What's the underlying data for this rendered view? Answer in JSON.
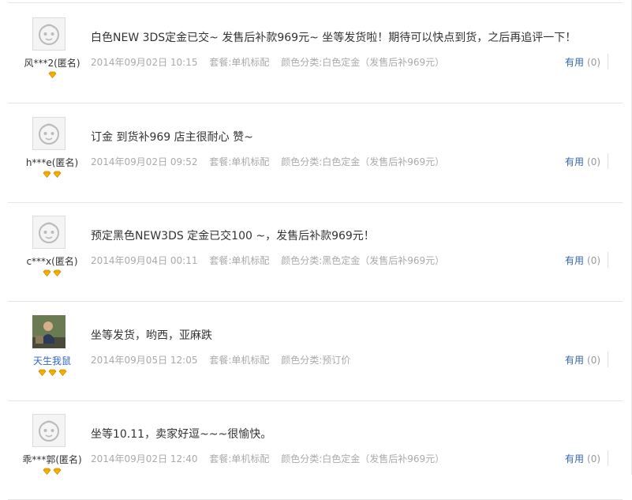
{
  "reviews": [
    {
      "nickname": "风***2(匿名)",
      "nickname_link": false,
      "avatar": "default",
      "badges": 1,
      "content": "白色NEW 3DS定金已交~ 发售后补款969元~ 坐等发货啦！期待可以快点到货，之后再追评一下！",
      "date": "2014年09月02日 10:15",
      "package": "套餐:单机标配",
      "color": "颜色分类:白色定金（发售后补969元）",
      "useful_label": "有用",
      "useful_count": "(0)"
    },
    {
      "nickname": "h***e(匿名)",
      "nickname_link": false,
      "avatar": "default",
      "badges": 2,
      "content": "订金 到货补969 店主很耐心 赞~",
      "date": "2014年09月02日 09:52",
      "package": "套餐:单机标配",
      "color": "颜色分类:白色定金（发售后补969元）",
      "useful_label": "有用",
      "useful_count": "(0)"
    },
    {
      "nickname": "c***x(匿名)",
      "nickname_link": false,
      "avatar": "default",
      "badges": 2,
      "content": "预定黑色NEW3DS 定金已交100 ~，发售后补款969元！",
      "date": "2014年09月04日 00:11",
      "package": "套餐:单机标配",
      "color": "颜色分类:黑色定金（发售后补969元）",
      "useful_label": "有用",
      "useful_count": "(0)"
    },
    {
      "nickname": "天生我鼠",
      "nickname_link": true,
      "avatar": "photo",
      "badges": 3,
      "content": "坐等发货，哟西，亚麻跌",
      "date": "2014年09月05日 12:05",
      "package": "套餐:单机标配",
      "color": "颜色分类:预订价",
      "useful_label": "有用",
      "useful_count": "(0)"
    },
    {
      "nickname": "乖***郭(匿名)",
      "nickname_link": false,
      "avatar": "default",
      "badges": 2,
      "content": "坐等10.11，卖家好逗~~~很愉快。",
      "date": "2014年09月02日 12:40",
      "package": "套餐:单机标配",
      "color": "颜色分类:白色定金（发售后补969元）",
      "useful_label": "有用",
      "useful_count": "(0)"
    }
  ],
  "colors": {
    "text": "#333333",
    "meta": "#aaaaaa",
    "link": "#3366aa",
    "badge": "#f5b400",
    "divider": "#e5e5e5"
  }
}
